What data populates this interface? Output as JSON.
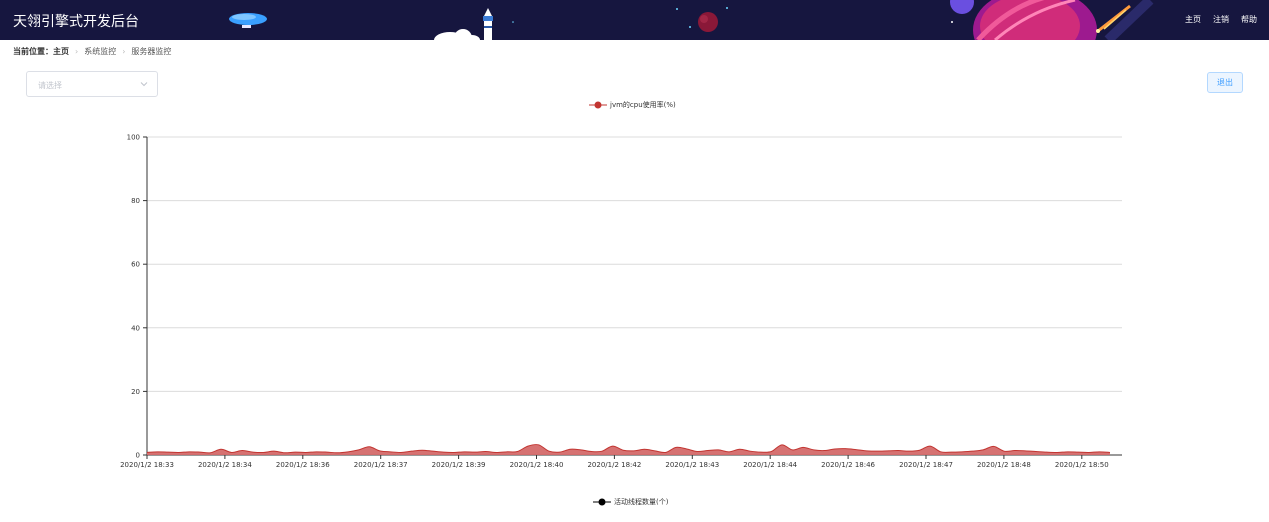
{
  "header": {
    "title": "天翎引擎式开发后台",
    "nav": [
      "主页",
      "注销",
      "帮助"
    ]
  },
  "breadcrumb": {
    "label": "当前位置：",
    "items": [
      "主页",
      "系统监控",
      "服务器监控"
    ]
  },
  "server_select": {
    "placeholder": "请选择"
  },
  "logout_label": "退出",
  "colors": {
    "header_bg": "#16163f",
    "series": "#c23531",
    "fill": "#d46a6a",
    "accent": "#409eff"
  },
  "chart_data": [
    {
      "type": "area",
      "series": [
        {
          "name": "jvm的cpu使用率(%)",
          "values": [
            0.8,
            1.0,
            0.9,
            0.8,
            1.0,
            0.9,
            0.7,
            1.8,
            0.8,
            1.4,
            0.9,
            0.8,
            1.2,
            0.7,
            0.9,
            0.8,
            1.0,
            0.9,
            0.7,
            1.0,
            1.6,
            2.6,
            1.3,
            1.0,
            0.8,
            1.2,
            1.5,
            1.2,
            0.9,
            0.8,
            1.0,
            0.9,
            1.1,
            0.8,
            1.0,
            1.1,
            2.8,
            3.2,
            1.2,
            0.9,
            1.8,
            1.6,
            1.1,
            1.2,
            2.8,
            1.5,
            1.3,
            1.8,
            1.3,
            0.8,
            2.4,
            1.9,
            1.1,
            1.4,
            1.6,
            1.0,
            1.8,
            1.2,
            0.9,
            1.1,
            3.2,
            1.6,
            2.4,
            1.6,
            1.4,
            1.9,
            2.0,
            1.7,
            1.3,
            1.2,
            1.3,
            1.4,
            1.2,
            1.5,
            2.8,
            1.0,
            0.9,
            1.0,
            1.2,
            1.6,
            2.7,
            1.2,
            1.4,
            1.3,
            1.1,
            0.9,
            0.8,
            1.0,
            0.9,
            0.8,
            1.0,
            0.8
          ]
        }
      ],
      "x_labels": [
        "2020/1/2 18:33",
        "2020/1/2 18:34",
        "2020/1/2 18:36",
        "2020/1/2 18:37",
        "2020/1/2 18:39",
        "2020/1/2 18:40",
        "2020/1/2 18:42",
        "2020/1/2 18:43",
        "2020/1/2 18:44",
        "2020/1/2 18:46",
        "2020/1/2 18:47",
        "2020/1/2 18:48",
        "2020/1/2 18:50"
      ],
      "ylim": [
        0,
        100
      ],
      "y_ticks": [
        0,
        20,
        40,
        60,
        80,
        100
      ],
      "grid": true,
      "legend_position": "top-center"
    },
    {
      "type": "line",
      "series": [
        {
          "name": "活动线程数量(个)"
        }
      ],
      "legend_position": "top-center"
    }
  ]
}
